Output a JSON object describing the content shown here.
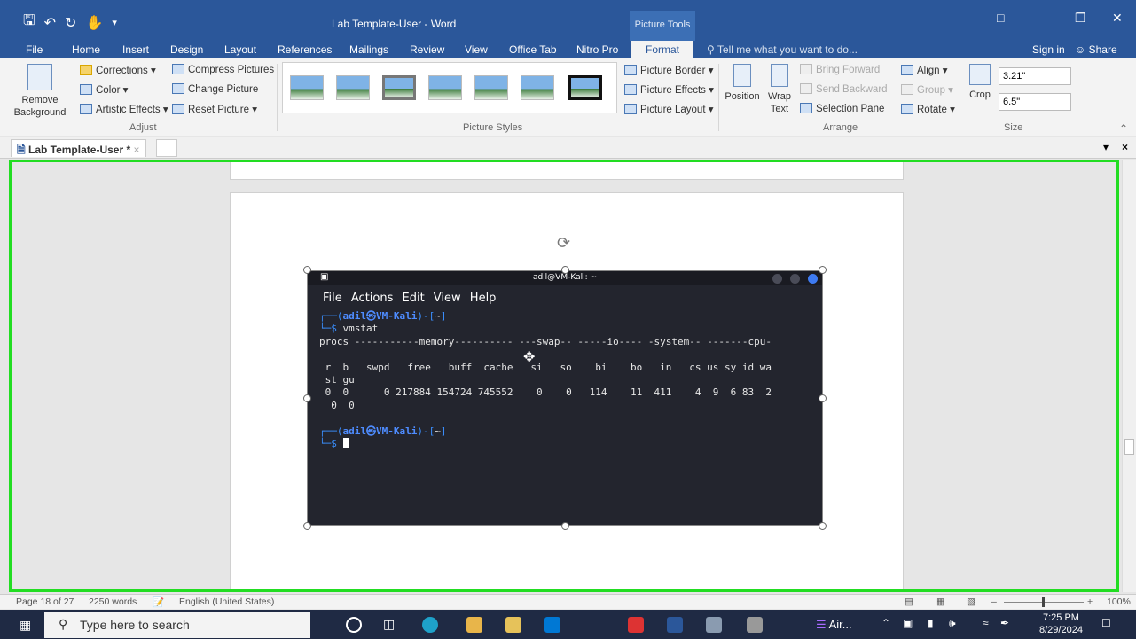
{
  "titlebar": {
    "doc_title": "Lab Template-User  -  Word",
    "contextual": "Picture Tools",
    "qat_icons": [
      "save-icon",
      "undo-icon",
      "redo-icon",
      "touch-mode-icon",
      "customize-icon"
    ]
  },
  "tabs": [
    "File",
    "Home",
    "Insert",
    "Design",
    "Layout",
    "References",
    "Mailings",
    "Review",
    "View",
    "Office Tab",
    "Nitro Pro",
    "Format"
  ],
  "tellme": "Tell me what you want to do...",
  "signin": "Sign in",
  "share": "Share",
  "ribbon": {
    "remove_bg": "Remove Background",
    "corrections": "Corrections",
    "color": "Color",
    "artistic": "Artistic Effects",
    "compress": "Compress Pictures",
    "change": "Change Picture",
    "reset": "Reset Picture",
    "adjust_label": "Adjust",
    "styles_label": "Picture Styles",
    "border": "Picture Border",
    "effects": "Picture Effects",
    "layout": "Picture Layout",
    "position": "Position",
    "wrap": "Wrap Text",
    "bring_forward": "Bring Forward",
    "send_backward": "Send Backward",
    "selection_pane": "Selection Pane",
    "align": "Align",
    "group": "Group",
    "rotate": "Rotate",
    "arrange_label": "Arrange",
    "crop": "Crop",
    "height": "3.21\"",
    "width": "6.5\"",
    "size_label": "Size"
  },
  "doctab": "Lab Template-User *",
  "terminal": {
    "title": "adil@VM-Kali: ~",
    "menu": "File Actions Edit View Help",
    "prompt_user": "adil",
    "prompt_host": "VM-Kali",
    "prompt_dir": "~",
    "command": "vmstat",
    "header1": "procs -----------memory---------- ---swap-- -----io---- -system-- -------cpu-",
    "header2": " r  b   swpd   free   buff  cache   si   so    bi    bo   in   cs us sy id wa",
    "header3": " st gu",
    "row1": " 0  0      0 217884 154724 745552    0    0   114    11  411    4  9  6 83  2",
    "row2": "  0  0"
  },
  "status": {
    "page": "Page 18 of 27",
    "words": "2250 words",
    "language": "English (United States)",
    "zoom": "100%"
  },
  "taskbar": {
    "search": "Type here to search",
    "app_label": "Air...",
    "time": "7:25 PM",
    "date": "8/29/2024"
  }
}
